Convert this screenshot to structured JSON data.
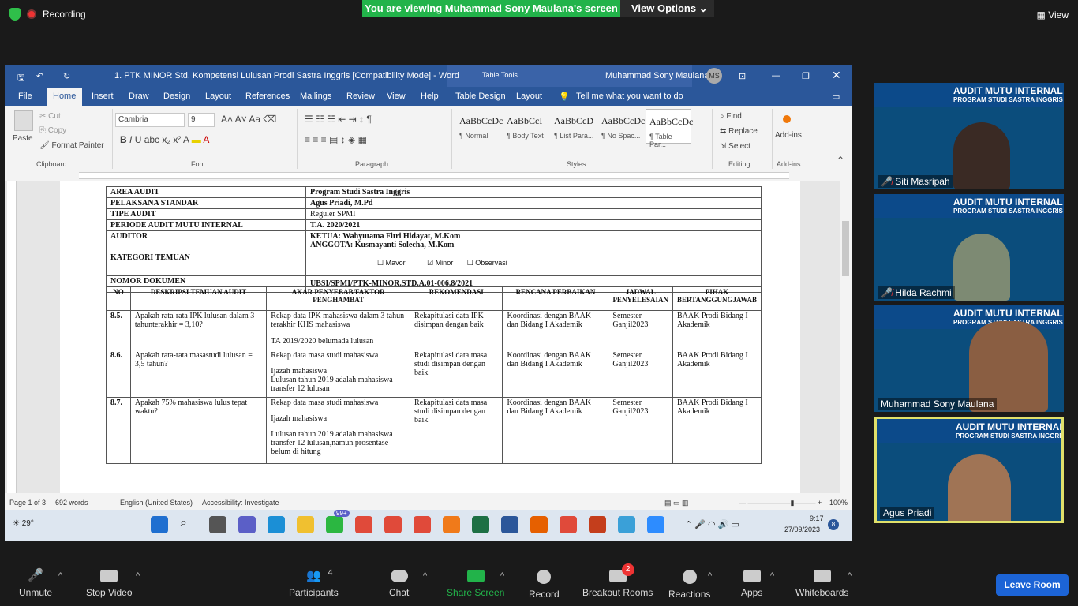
{
  "zoom": {
    "recording": "Recording",
    "viewing": "You are viewing Muhammad Sony Maulana's screen",
    "view_options": "View Options",
    "view": "View",
    "buttons": {
      "unmute": "Unmute",
      "stop_video": "Stop Video",
      "participants": "Participants",
      "participants_count": "4",
      "chat": "Chat",
      "share_screen": "Share Screen",
      "record": "Record",
      "breakout": "Breakout Rooms",
      "breakout_badge": "2",
      "reactions": "Reactions",
      "apps": "Apps",
      "whiteboards": "Whiteboards",
      "leave": "Leave Room"
    },
    "participants": [
      {
        "name": "Siti Masripah"
      },
      {
        "name": "Hilda Rachmi"
      },
      {
        "name": "Muhammad Sony Maulana"
      },
      {
        "name": "Agus Priadi"
      }
    ],
    "banner_title": "AUDIT MUTU INTERNAL",
    "banner_sub": "PROGRAM STUDI SASTRA INGGRIS"
  },
  "word": {
    "title": "1. PTK MINOR Std. Kompetensi Lulusan Prodi Sastra Inggris [Compatibility Mode]  -  Word",
    "table_tools": "Table Tools",
    "user": "Muhammad Sony Maulana",
    "initials": "MS",
    "tabs": [
      "File",
      "Home",
      "Insert",
      "Draw",
      "Design",
      "Layout",
      "References",
      "Mailings",
      "Review",
      "View",
      "Help",
      "Table Design",
      "Layout"
    ],
    "tell_me": "Tell me what you want to do",
    "clipboard": {
      "paste": "Paste",
      "cut": "Cut",
      "copy": "Copy",
      "format_painter": "Format Painter",
      "group": "Clipboard"
    },
    "font": {
      "name": "Cambria",
      "size": "9",
      "group": "Font"
    },
    "paragraph": {
      "group": "Paragraph"
    },
    "styles": {
      "group": "Styles",
      "items": [
        {
          "sample": "AaBbCcDc",
          "name": "¶ Normal"
        },
        {
          "sample": "AaBbCcI",
          "name": "¶ Body Text"
        },
        {
          "sample": "AaBbCcD",
          "name": "¶ List Para..."
        },
        {
          "sample": "AaBbCcDc",
          "name": "¶ No Spac..."
        },
        {
          "sample": "AaBbCcDc",
          "name": "¶ Table Par..."
        }
      ]
    },
    "editing": {
      "find": "Find",
      "replace": "Replace",
      "select": "Select",
      "group": "Editing"
    },
    "addins": {
      "label": "Add-ins",
      "group": "Add-ins"
    },
    "status": {
      "page": "Page 1 of 3",
      "words": "692 words",
      "lang": "English (United States)",
      "access": "Accessibility: Investigate",
      "zoom": "100%"
    },
    "taskbar": {
      "weather": "29°",
      "time": "9:17",
      "date": "27/09/2023",
      "wa_badge": "99+",
      "notif": "8"
    }
  },
  "doc": {
    "info": [
      [
        "AREA AUDIT",
        "Program Studi Sastra Inggris"
      ],
      [
        "PELAKSANA STANDAR",
        "Agus Priadi, M.Pd"
      ],
      [
        "TIPE AUDIT",
        "Reguler SPMI"
      ],
      [
        "PERIODE AUDIT MUTU INTERNAL",
        "T.A. 2020/2021"
      ]
    ],
    "auditor_label": "AUDITOR",
    "ketua": "KETUA: Wahyutama Fitri Hidayat, M.Kom",
    "anggota": "ANGGOTA: Kusmayanti Solecha, M.Kom",
    "kategori_label": "KATEGORI TEMUAN",
    "mayor": "Mavor",
    "minor": "Minor",
    "observasi": "Observasi",
    "nomor_label": "NOMOR DOKUMEN",
    "nomor": "UBSI/SPMI/PTK-MINOR.STD.A.01-006.8/2021",
    "headers": [
      "NO",
      "DESKRIPSI TEMUAN AUDIT",
      "AKAR PENYEBAB/FAKTOR PENGHAMBAT",
      "REKOMENDASI",
      "RENCANA PERBAIKAN",
      "JADWAL PENYELESAIAN",
      "PIHAK BERTANGGUNGJAWAB"
    ],
    "rows": [
      {
        "no": "8.5.",
        "desk": "Apakah rata-rata IPK lulusan dalam 3 tahunterakhir = 3,10?",
        "akar1": "Rekap data IPK mahasiswa dalam 3 tahun terakhir KHS mahasiswa",
        "akar2": "TA 2019/2020 belumada lulusan",
        "akar3": "",
        "rek": "Rekapitulasi data IPK disimpan dengan baik",
        "ren": "Koordinasi dengan BAAK dan Bidang I Akademik",
        "jad": "Semester Ganjil2023",
        "pih": "BAAK Prodi Bidang I Akademik"
      },
      {
        "no": "8.6.",
        "desk": "Apakah rata-rata masastudi lulusan = 3,5 tahun?",
        "akar1": "Rekap data masa studi mahasiswa",
        "akar2": "Ijazah mahasiswa",
        "akar3": "Lulusan tahun 2019 adalah mahasiswa transfer 12 lulusan",
        "rek": "Rekapitulasi data masa studi disimpan dengan baik",
        "ren": "Koordinasi dengan BAAK dan Bidang I Akademik",
        "jad": "Semester Ganjil2023",
        "pih": "BAAK Prodi Bidang I Akademik"
      },
      {
        "no": "8.7.",
        "desk": "Apakah 75% mahasiswa lulus tepat waktu?",
        "akar1": "Rekap data masa studi mahasiswa",
        "akar2": "Ijazah mahasiswa",
        "akar3": "Lulusan tahun 2019 adalah mahasiswa transfer 12 lulusan,namun prosentase belum di hitung",
        "rek": "Rekapitulasi data masa studi disimpan dengan baik",
        "ren": "Koordinasi dengan BAAK dan Bidang I Akademik",
        "jad": "Semester Ganjil2023",
        "pih": "BAAK Prodi Bidang I Akademik"
      }
    ]
  },
  "colors": {
    "zoom_green": "#22b34a",
    "word_blue": "#2b579a",
    "leave_blue": "#1c64d6"
  }
}
